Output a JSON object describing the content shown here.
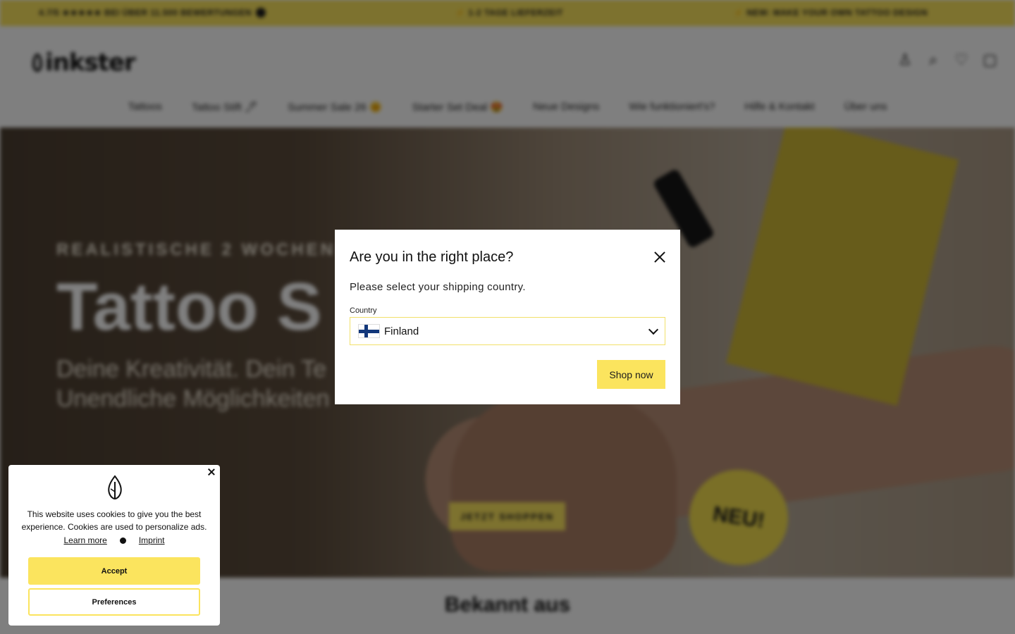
{
  "announcement": {
    "left": "4.7/5 ★★★★★ BEI ÜBER 11.500 BEWERTUNGEN",
    "center": "⚡ 1-2 TAGE LIEFERZEIT",
    "right": "⚡ NEW: MAKE YOUR OWN TATTOO DESIGN"
  },
  "header": {
    "logo": "inkster"
  },
  "nav": {
    "items": [
      "Tattoos",
      "Tattoo Stift 🖊",
      "Summer Sale 26 🌞",
      "Starter Set Deal 😍",
      "Neue Designs",
      "Wie funktioniert's?",
      "Hilfe & Kontakt",
      "Über uns"
    ]
  },
  "hero": {
    "kicker": "REALISTISCHE 2 WOCHEN TATTOOS",
    "title": "Tattoo S",
    "subtitle_line1": "Deine Kreativität. Dein Te",
    "subtitle_line2": "Unendliche Möglichkeiten",
    "cta": "JETZT SHOPPEN",
    "badge": "NEU!"
  },
  "section": {
    "title": "Bekannt aus"
  },
  "modal": {
    "title": "Are you in the right place?",
    "description": "Please select your shipping country.",
    "country_label": "Country",
    "country_value": "Finland",
    "flag_icon": "finland-flag-icon",
    "shop_button": "Shop now"
  },
  "cookie": {
    "text": "This website uses cookies to give you the best experience. Cookies are used to personalize ads.",
    "learn_more": "Learn more",
    "imprint": "Imprint",
    "accept": "Accept",
    "preferences": "Preferences"
  },
  "colors": {
    "brand_yellow": "#fbe45e",
    "overlay": "rgba(0,0,0,0.5)"
  }
}
